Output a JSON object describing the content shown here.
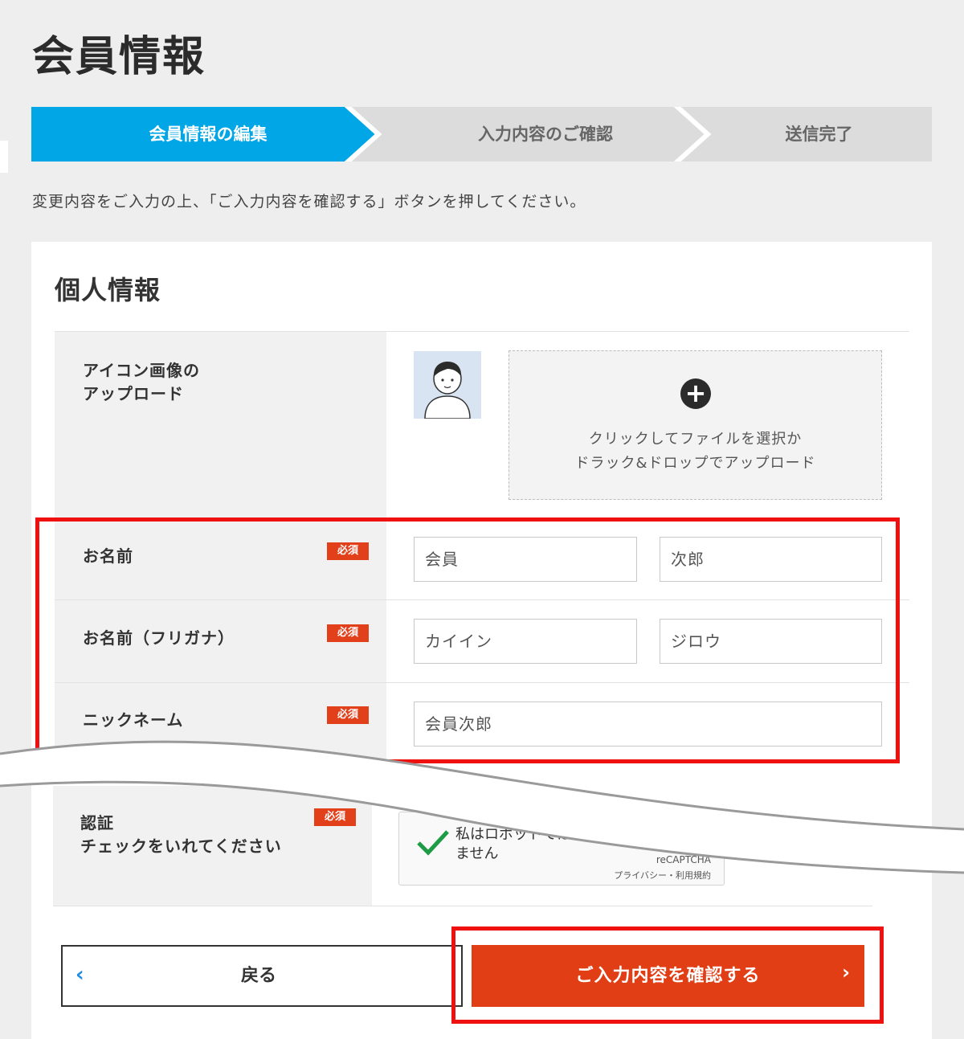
{
  "page": {
    "title": "会員情報",
    "instruction": "変更内容をご入力の上、「ご入力内容を確認する」ボタンを押してください。"
  },
  "steps": [
    {
      "label": "会員情報の編集",
      "active": true
    },
    {
      "label": "入力内容のご確認",
      "active": false
    },
    {
      "label": "送信完了",
      "active": false
    }
  ],
  "section": {
    "title": "個人情報"
  },
  "icon_upload": {
    "label_line1": "アイコン画像の",
    "label_line2": "アップロード",
    "drop_text_line1": "クリックしてファイルを選択か",
    "drop_text_line2": "ドラック&ドロップでアップロード"
  },
  "required_badge": "必須",
  "fields": {
    "name": {
      "label": "お名前",
      "last_name": "会員",
      "first_name": "次郎"
    },
    "name_kana": {
      "label": "お名前（フリガナ）",
      "last_name": "カイイン",
      "first_name": "ジロウ"
    },
    "nickname": {
      "label": "ニックネーム",
      "value": "会員次郎"
    },
    "auth": {
      "label_line1": "認証",
      "label_line2": "チェックをいれてください",
      "captcha_text_line1": "私はロボットでは",
      "captcha_text_line2": "ません",
      "captcha_brand": "reCAPTCHA",
      "captcha_links": "プライバシー・利用規約"
    }
  },
  "buttons": {
    "back": "戻る",
    "back_arrow": "‹",
    "confirm": "ご入力内容を確認する",
    "confirm_arrow": "›"
  },
  "colors": {
    "step_active": "#00a6e6",
    "step_inactive": "#dcdcdc",
    "badge": "#e2401b",
    "confirm_button": "#e23e16",
    "highlight": "#ef1010"
  }
}
